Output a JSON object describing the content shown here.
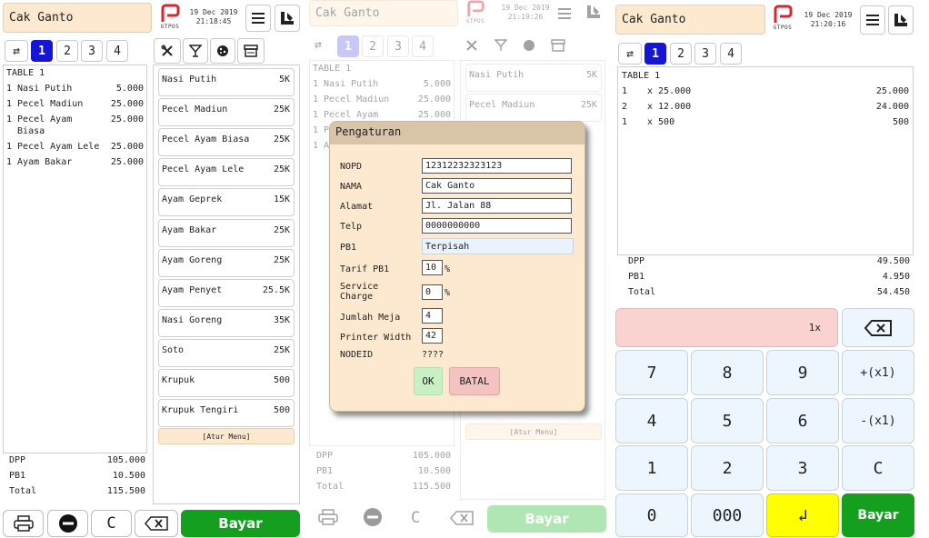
{
  "panel1": {
    "store_name": "Cak Ganto",
    "logo_text": "GTPOS",
    "date": "19 Dec 2019",
    "time": "21:18:45",
    "tabs": [
      "1",
      "2",
      "3",
      "4"
    ],
    "table_label": "TABLE 1",
    "order_rows": [
      {
        "name": "1 Nasi Putih",
        "price": "5.000"
      },
      {
        "name": "1 Pecel Madiun",
        "price": "25.000"
      },
      {
        "name": "1 Pecel Ayam\n  Biasa",
        "price": "25.000"
      },
      {
        "name": "1 Pecel Ayam Lele",
        "price": "25.000"
      },
      {
        "name": "1 Ayam Bakar",
        "price": "25.000"
      }
    ],
    "menu_items": [
      {
        "name": "Nasi Putih",
        "price": "5K"
      },
      {
        "name": "Pecel Madiun",
        "price": "25K"
      },
      {
        "name": "Pecel Ayam Biasa",
        "price": "25K"
      },
      {
        "name": "Pecel Ayam Lele",
        "price": "25K"
      },
      {
        "name": "Ayam Geprek",
        "price": "15K"
      },
      {
        "name": "Ayam Bakar",
        "price": "25K"
      },
      {
        "name": "Ayam Goreng",
        "price": "25K"
      },
      {
        "name": "Ayam Penyet",
        "price": "25.5K"
      },
      {
        "name": "Nasi Goreng",
        "price": "35K"
      },
      {
        "name": "Soto",
        "price": "25K"
      },
      {
        "name": "Krupuk",
        "price": "500"
      },
      {
        "name": "Krupuk Tengiri",
        "price": "500"
      }
    ],
    "atur_menu": "[Atur Menu]",
    "totals": [
      {
        "label": "DPP",
        "value": "105.000"
      },
      {
        "label": "PB1",
        "value": "10.500"
      },
      {
        "label": "Total",
        "value": "115.500"
      }
    ],
    "clear_label": "C",
    "bayar_label": "Bayar"
  },
  "panel2": {
    "store_name": "Cak Ganto",
    "logo_text": "GTPOS",
    "date": "19 Dec 2019",
    "time": "21:19:26",
    "tabs": [
      "1",
      "2",
      "3",
      "4"
    ],
    "table_label": "TABLE 1",
    "order_rows": [
      {
        "name": "1 Nasi Putih",
        "price": "5.000"
      },
      {
        "name": "1 Pecel Madiun",
        "price": "25.000"
      },
      {
        "name": "1 Pecel Ayam",
        "price": "25.000"
      },
      {
        "name": "1 P",
        "price": ""
      },
      {
        "name": "1 A",
        "price": ""
      }
    ],
    "menu_items": [
      {
        "name": "Nasi Putih",
        "price": "5K"
      },
      {
        "name": "Pecel Madiun",
        "price": "25K"
      }
    ],
    "atur_menu": "[Atur Menu]",
    "totals": [
      {
        "label": "DPP",
        "value": "105.000"
      },
      {
        "label": "PB1",
        "value": "10.500"
      },
      {
        "label": "Total",
        "value": "115.500"
      }
    ],
    "clear_label": "C",
    "bayar_label": "Bayar"
  },
  "dialog": {
    "title": "Pengaturan",
    "fields": {
      "nopd_label": "NOPD",
      "nopd_value": "12312232323123",
      "nama_label": "NAMA",
      "nama_value": "Cak Ganto",
      "alamat_label": "Alamat",
      "alamat_value": "Jl. Jalan 88",
      "telp_label": "Telp",
      "telp_value": "0000000000",
      "pb1_label": "PB1",
      "pb1_value": "Terpisah",
      "tarif_label": "Tarif PB1",
      "tarif_value": "10",
      "tarif_unit": "%",
      "service_label": "Service\nCharge",
      "service_value": "0",
      "service_unit": "%",
      "meja_label": "Jumlah Meja",
      "meja_value": "4",
      "printer_label": "Printer Width",
      "printer_value": "42",
      "nodeid_label": "NODEID",
      "nodeid_value": "????"
    },
    "ok_label": "OK",
    "batal_label": "BATAL"
  },
  "panel3": {
    "store_name": "Cak Ganto",
    "logo_text": "GTPOS",
    "date": "19 Dec 2019",
    "time": "21:20:16",
    "tabs": [
      "1",
      "2",
      "3",
      "4"
    ],
    "table_label": "TABLE 1",
    "order_rows": [
      {
        "qty": "1",
        "desc": "x 25.000",
        "price": "25.000"
      },
      {
        "qty": "2",
        "desc": "x 12.000",
        "price": "24.000"
      },
      {
        "qty": "1",
        "desc": "x 500",
        "price": "500"
      }
    ],
    "totals": [
      {
        "label": "DPP",
        "value": "49.500"
      },
      {
        "label": "PB1",
        "value": "4.950"
      },
      {
        "label": "Total",
        "value": "54.450"
      }
    ],
    "qty_display": "1x",
    "keys": {
      "k7": "7",
      "k8": "8",
      "k9": "9",
      "plus": "+(x1)",
      "k4": "4",
      "k5": "5",
      "k6": "6",
      "minus": "-(x1)",
      "k1": "1",
      "k2": "2",
      "k3": "3",
      "clear": "C",
      "k0": "0",
      "k000": "000",
      "enter": "↲",
      "bayar": "Bayar"
    }
  }
}
